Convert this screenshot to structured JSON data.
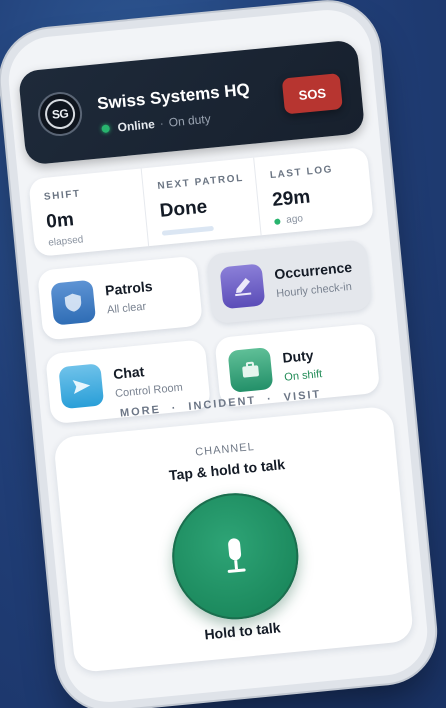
{
  "header": {
    "logo_text": "SG",
    "org_name": "Swiss Systems HQ",
    "status_online": "Online",
    "status_separator": "·",
    "status_duty": "On duty",
    "sos_label": "SOS"
  },
  "stats": [
    {
      "label": "SHIFT",
      "value": "0m",
      "sub": "elapsed"
    },
    {
      "label": "NEXT PATROL",
      "value": "Done",
      "sub": ""
    },
    {
      "label": "LAST LOG",
      "value": "29m",
      "sub": "ago"
    }
  ],
  "tiles": [
    {
      "title": "Patrols",
      "sub": "All clear",
      "icon": "shield-icon",
      "color": "#2f6db5"
    },
    {
      "title": "Occurrence",
      "sub": "Hourly check-in",
      "icon": "pencil-icon",
      "color": "#5b4db8"
    },
    {
      "title": "Chat",
      "sub": "Control Room",
      "icon": "send-icon",
      "color": "#2a9fd8"
    },
    {
      "title": "Duty",
      "sub": "On shift",
      "icon": "briefcase-icon",
      "color": "#239069"
    }
  ],
  "quick_links": {
    "more": "MORE",
    "incident": "INCIDENT",
    "visit": "VISIT",
    "separator": "·"
  },
  "ptt": {
    "channel_label": "CHANNEL",
    "instruction": "Tap & hold to talk",
    "button_label": "Hold to talk",
    "button_icon": "microphone-icon",
    "button_color": "#1f8f61"
  },
  "colors": {
    "accent_green": "#28b46e",
    "sos_red": "#b73530",
    "header_bg": "#1e2a3a"
  }
}
